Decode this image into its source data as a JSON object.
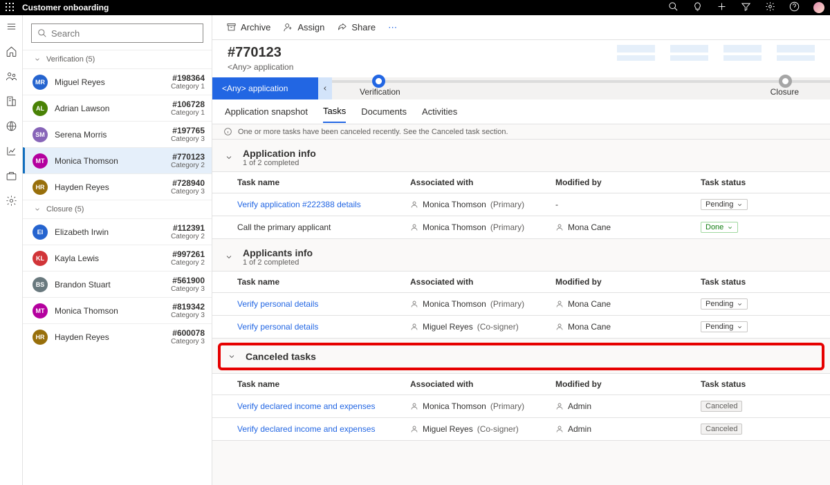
{
  "topbar": {
    "title": "Customer onboarding"
  },
  "search": {
    "placeholder": "Search"
  },
  "groups": {
    "verification": {
      "label": "Verification (5)"
    },
    "closure": {
      "label": "Closure (5)"
    }
  },
  "customers": {
    "verification": [
      {
        "initials": "MR",
        "name": "Miguel Reyes",
        "id": "#198364",
        "cat": "Category 1",
        "color": "#2564cf"
      },
      {
        "initials": "AL",
        "name": "Adrian Lawson",
        "id": "#106728",
        "cat": "Category 1",
        "color": "#498205"
      },
      {
        "initials": "SM",
        "name": "Serena Morris",
        "id": "#197765",
        "cat": "Category 3",
        "color": "#8764b8"
      },
      {
        "initials": "MT",
        "name": "Monica Thomson",
        "id": "#770123",
        "cat": "Category 2",
        "color": "#b4009e"
      },
      {
        "initials": "HR",
        "name": "Hayden Reyes",
        "id": "#728940",
        "cat": "Category 3",
        "color": "#986f0b"
      }
    ],
    "closure": [
      {
        "initials": "EI",
        "name": "Elizabeth Irwin",
        "id": "#112391",
        "cat": "Category 2",
        "color": "#2564cf"
      },
      {
        "initials": "KL",
        "name": "Kayla Lewis",
        "id": "#997261",
        "cat": "Category 2",
        "color": "#d13438"
      },
      {
        "initials": "BS",
        "name": "Brandon Stuart",
        "id": "#561900",
        "cat": "Category 3",
        "color": "#69797e"
      },
      {
        "initials": "MT",
        "name": "Monica Thomson",
        "id": "#819342",
        "cat": "Category 3",
        "color": "#b4009e"
      },
      {
        "initials": "HR",
        "name": "Hayden Reyes",
        "id": "#600078",
        "cat": "Category 3",
        "color": "#986f0b"
      }
    ]
  },
  "cmd": {
    "archive": "Archive",
    "assign": "Assign",
    "share": "Share"
  },
  "header": {
    "title": "#770123",
    "subtitle": "<Any> application"
  },
  "bpf": {
    "stage": "<Any> application",
    "node1": "Verification",
    "node2": "Closure"
  },
  "tabs": {
    "t1": "Application snapshot",
    "t2": "Tasks",
    "t3": "Documents",
    "t4": "Activities"
  },
  "info": "One or more tasks have been canceled recently. See the Canceled task section.",
  "columns": {
    "c1": "Task name",
    "c2": "Associated with",
    "c3": "Modified by",
    "c4": "Task status"
  },
  "sec": {
    "appinfo": {
      "title": "Application info",
      "sub": "1 of 2 completed"
    },
    "applicants": {
      "title": "Applicants info",
      "sub": "1 of 2 completed"
    },
    "canceled": {
      "title": "Canceled tasks"
    }
  },
  "tasks": {
    "appinfo": [
      {
        "name": "Verify application #222388 details",
        "link": true,
        "assoc": "Monica Thomson",
        "role": "(Primary)",
        "mod": "-",
        "status": "Pending",
        "drop": true
      },
      {
        "name": "Call the primary applicant",
        "link": false,
        "assoc": "Monica Thomson",
        "role": "(Primary)",
        "mod": "Mona Cane",
        "status": "Done",
        "drop": true,
        "green": true
      }
    ],
    "applicants": [
      {
        "name": "Verify personal details",
        "link": true,
        "assoc": "Monica Thomson",
        "role": "(Primary)",
        "mod": "Mona Cane",
        "status": "Pending",
        "drop": true
      },
      {
        "name": "Verify personal details",
        "link": true,
        "assoc": "Miguel Reyes",
        "role": "(Co-signer)",
        "mod": "Mona Cane",
        "status": "Pending",
        "drop": true
      }
    ],
    "canceled": [
      {
        "name": "Verify declared income and expenses",
        "link": true,
        "assoc": "Monica Thomson",
        "role": "(Primary)",
        "mod": "Admin",
        "status": "Canceled",
        "grey": true
      },
      {
        "name": "Verify declared income and expenses",
        "link": true,
        "assoc": "Miguel Reyes",
        "role": "(Co-signer)",
        "mod": "Admin",
        "status": "Canceled",
        "grey": true
      }
    ]
  }
}
